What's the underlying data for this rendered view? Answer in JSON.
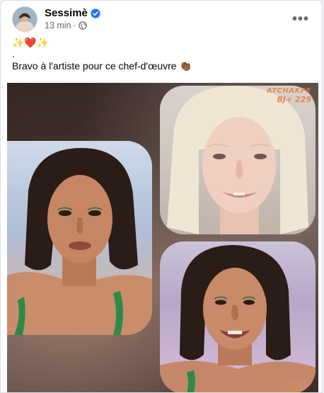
{
  "post": {
    "author": "Sessimè",
    "time": "13 min",
    "separator": "·",
    "caption_emojis": "✨❤️✨",
    "caption_dot": ".",
    "caption_text": "Bravo à l'artiste pour ce chef-d'œuvre 👏🏾",
    "more_label": "•••"
  },
  "image": {
    "watermark_line1": "ATCHAKPE",
    "watermark_line2": "BJ+ 229"
  },
  "icons": {
    "verified": "verified-badge-icon",
    "privacy": "globe-icon",
    "menu": "more-options-icon"
  },
  "colors": {
    "verified": "#1877f2",
    "meta_text": "#65676b",
    "card_bg": "#ffffff"
  }
}
